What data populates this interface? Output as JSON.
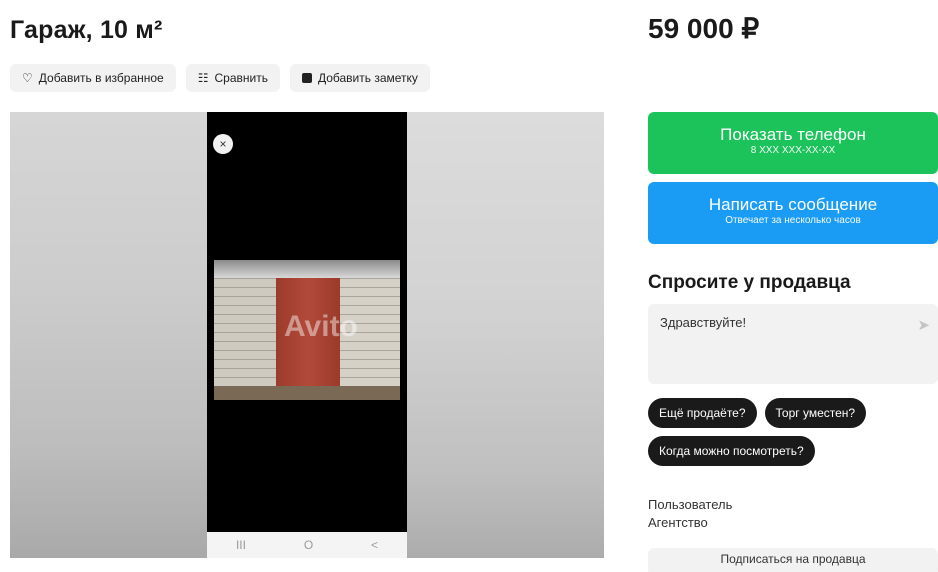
{
  "listing": {
    "title": "Гараж, 10 м²",
    "price": "59 000 ₽"
  },
  "actions": {
    "favorite_label": "Добавить в избранное",
    "compare_label": "Сравнить",
    "note_label": "Добавить заметку"
  },
  "icons": {
    "favorite": "heart-icon",
    "compare": "compare-icon",
    "note": "note-icon",
    "close": "close-icon",
    "send": "send-icon"
  },
  "gallery": {
    "watermark": "Avito",
    "close_glyph": "×",
    "nav": [
      "III",
      "O",
      "<"
    ]
  },
  "contact": {
    "phone_label": "Показать телефон",
    "phone_masked": "8 XXX XXX-XX-XX",
    "message_label": "Написать сообщение",
    "message_sub": "Отвечает за несколько часов"
  },
  "ask": {
    "title": "Спросите у продавца",
    "input_value": "Здравствуйте!",
    "chips": [
      "Ещё продаёте?",
      "Торг уместен?",
      "Когда можно посмотреть?"
    ]
  },
  "seller": {
    "name": "Пользователь",
    "type": "Агентство",
    "subscribe_label": "Подписаться на продавца"
  },
  "colors": {
    "green": "#1cc35b",
    "blue": "#1a9cf5",
    "chip_dark": "#1a1a1a",
    "surface": "#f2f2f2"
  }
}
